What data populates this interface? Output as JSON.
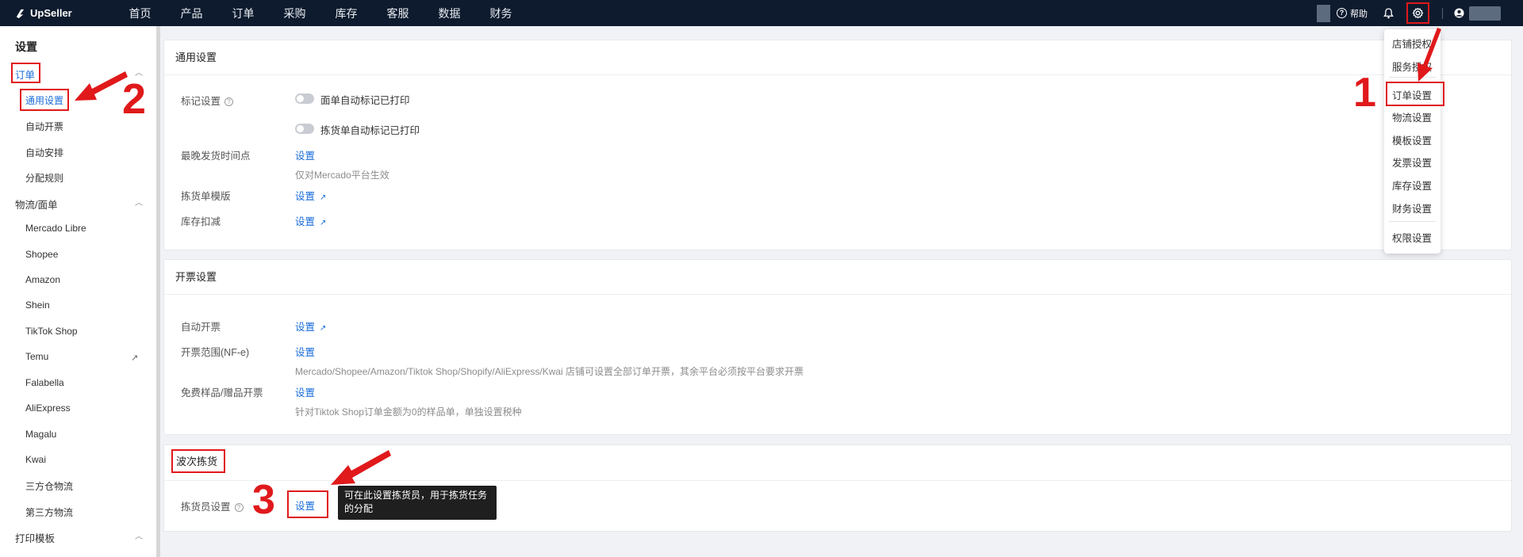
{
  "app": {
    "logo_text": "UpSeller",
    "nav": [
      "首页",
      "产品",
      "订单",
      "采购",
      "库存",
      "客服",
      "数据",
      "财务"
    ],
    "help_label": "帮助"
  },
  "sidebar": {
    "title": "设置",
    "groups": [
      {
        "label": "订单",
        "items": [
          "通用设置",
          "自动开票",
          "自动安排",
          "分配规则"
        ]
      },
      {
        "label": "物流/面单",
        "items": [
          "Mercado Libre",
          "Shopee",
          "Amazon",
          "Shein",
          "TikTok Shop",
          "Temu",
          "Falabella",
          "AliExpress",
          "Magalu",
          "Kwai",
          "三方仓物流",
          "第三方物流"
        ]
      },
      {
        "label": "打印模板",
        "items": []
      }
    ]
  },
  "general": {
    "title": "通用设置",
    "mark_label": "标记设置",
    "toggle1": "面单自动标记已打印",
    "toggle2": "拣货单自动标记已打印",
    "deadline_label": "最晚发货时间点",
    "deadline_link": "设置",
    "deadline_note": "仅对Mercado平台生效",
    "picklist_label": "拣货单模版",
    "picklist_link": "设置",
    "stock_label": "库存扣减",
    "stock_link": "设置"
  },
  "invoice": {
    "title": "开票设置",
    "auto_label": "自动开票",
    "auto_link": "设置",
    "scope_label": "开票范围(NF-e)",
    "scope_link": "设置",
    "scope_note": "Mercado/Shopee/Amazon/Tiktok Shop/Shopify/AliExpress/Kwai 店铺可设置全部订单开票，其余平台必须按平台要求开票",
    "free_label": "免费样品/赠品开票",
    "free_link": "设置",
    "free_note": "针对Tiktok Shop订单金额为0的样品单，单独设置税种"
  },
  "wave": {
    "title": "波次拣货",
    "picker_label": "拣货员设置",
    "picker_link": "设置",
    "tooltip": "可在此设置拣货员，用于拣货任务的分配"
  },
  "dropdown": {
    "items": [
      "店铺授权",
      "服务授权",
      "订单设置",
      "物流设置",
      "模板设置",
      "发票设置",
      "库存设置",
      "财务设置",
      "权限设置"
    ]
  },
  "steps": {
    "one": "1",
    "two": "2",
    "three": "3"
  },
  "colors": {
    "topbar": "#0e1b2e",
    "link": "#1a6ddb",
    "annotation": "#e0191b"
  }
}
